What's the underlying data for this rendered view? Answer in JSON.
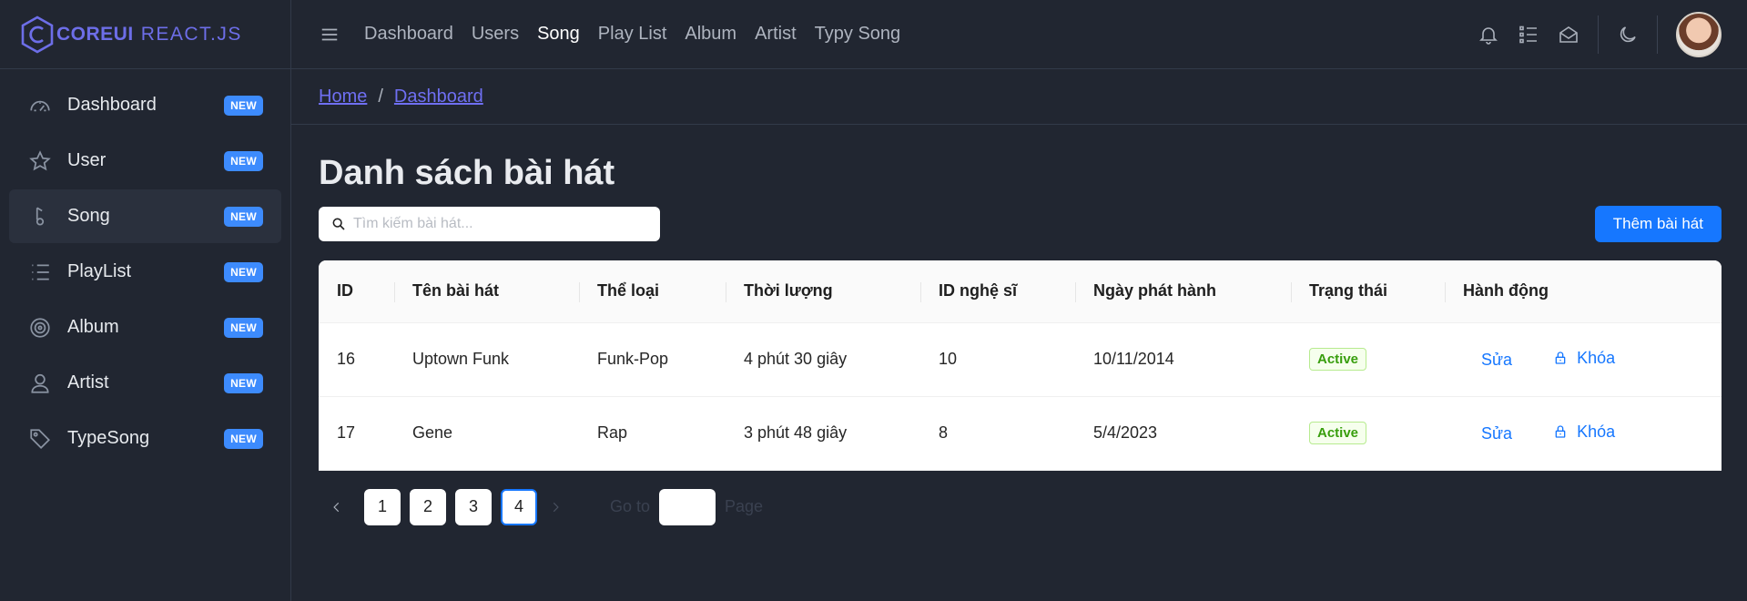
{
  "brand": {
    "core": "COREUI",
    "react": "REACT.JS"
  },
  "sidebar": {
    "items": [
      {
        "label": "Dashboard",
        "icon": "speedometer-icon",
        "badge": "NEW",
        "active": false
      },
      {
        "label": "User",
        "icon": "star-icon",
        "badge": "NEW",
        "active": false
      },
      {
        "label": "Song",
        "icon": "music-note-icon",
        "badge": "NEW",
        "active": true
      },
      {
        "label": "PlayList",
        "icon": "list-icon",
        "badge": "NEW",
        "active": false
      },
      {
        "label": "Album",
        "icon": "disc-icon",
        "badge": "NEW",
        "active": false
      },
      {
        "label": "Artist",
        "icon": "user-icon",
        "badge": "NEW",
        "active": false
      },
      {
        "label": "TypeSong",
        "icon": "tag-icon",
        "badge": "NEW",
        "active": false
      }
    ]
  },
  "header": {
    "nav": [
      "Dashboard",
      "Users",
      "Song",
      "Play List",
      "Album",
      "Artist",
      "Typy Song"
    ],
    "active_nav": "Song"
  },
  "breadcrumb": {
    "home": "Home",
    "current": "Dashboard"
  },
  "main": {
    "title": "Danh sách bài hát",
    "search_placeholder": "Tìm kiếm bài hát...",
    "add_button": "Thêm bài hát"
  },
  "table": {
    "columns": [
      "ID",
      "Tên bài hát",
      "Thể loại",
      "Thời lượng",
      "ID nghệ sĩ",
      "Ngày phát hành",
      "Trạng thái",
      "Hành động"
    ],
    "rows": [
      {
        "id": "16",
        "name": "Uptown Funk",
        "genre": "Funk-Pop",
        "duration": "4 phút 30 giây",
        "artist_id": "10",
        "release": "10/11/2014",
        "status": "Active",
        "edit": "Sửa",
        "lock": "Khóa"
      },
      {
        "id": "17",
        "name": "Gene",
        "genre": "Rap",
        "duration": "3 phút 48 giây",
        "artist_id": "8",
        "release": "5/4/2023",
        "status": "Active",
        "edit": "Sửa",
        "lock": "Khóa"
      }
    ]
  },
  "pagination": {
    "pages": [
      "1",
      "2",
      "3",
      "4"
    ],
    "current": "4",
    "goto_label": "Go to",
    "page_label": "Page"
  },
  "colors": {
    "accent": "#1677ff",
    "brand": "#6d6ee8",
    "badge": "#3d8bfd",
    "status_green": "#389e0d"
  }
}
